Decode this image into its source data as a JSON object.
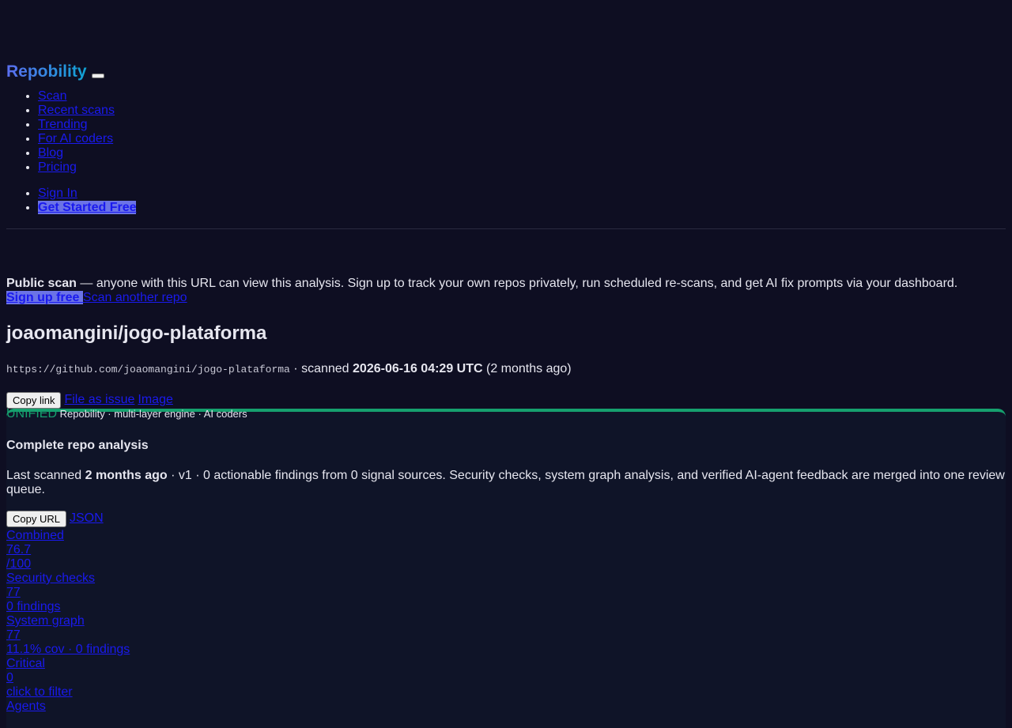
{
  "brand": {
    "name": "Repobility"
  },
  "nav": {
    "items": [
      "Scan",
      "Recent scans",
      "Trending",
      "For AI coders",
      "Blog",
      "Pricing"
    ],
    "sign_in": "Sign In",
    "get_started": "Get Started Free"
  },
  "notice": {
    "bold": "Public scan",
    "text": " — anyone with this URL can view this analysis. Sign up to track your own repos privately, run scheduled re-scans, and get AI fix prompts via your dashboard.",
    "signup": "Sign up free ",
    "scan_another": "Scan another repo"
  },
  "repo": {
    "title": "joaomangini/jogo-plataforma",
    "url": "https://github.com/joaomangini/jogo-plataforma",
    "scanned_prefix": " · scanned ",
    "scanned_at": "2026-06-16 04:29 UTC",
    "scanned_ago": " (2 months ago)",
    "copy_link": "Copy link",
    "file_issue": "File as issue",
    "image": "Image"
  },
  "panel": {
    "badge": "UNIFIED",
    "subtitle": " Repobility · multi-layer engine · AI coders",
    "heading": "Complete repo analysis",
    "desc_prefix": "Last scanned ",
    "desc_bold": "2 months ago",
    "desc_suffix": " · v1 · 0 actionable findings from 0 signal sources. Security checks, system graph analysis, and verified AI-agent feedback are merged into one review queue.",
    "copy_url": "Copy URL",
    "json": "JSON",
    "stats": [
      "Combined",
      "76.7",
      "/100",
      "Security checks",
      "77",
      "0 findings",
      "System graph",
      "77",
      "11.1% cov · 0 findings",
      "Critical",
      "0",
      "click to filter",
      "Agents"
    ]
  }
}
